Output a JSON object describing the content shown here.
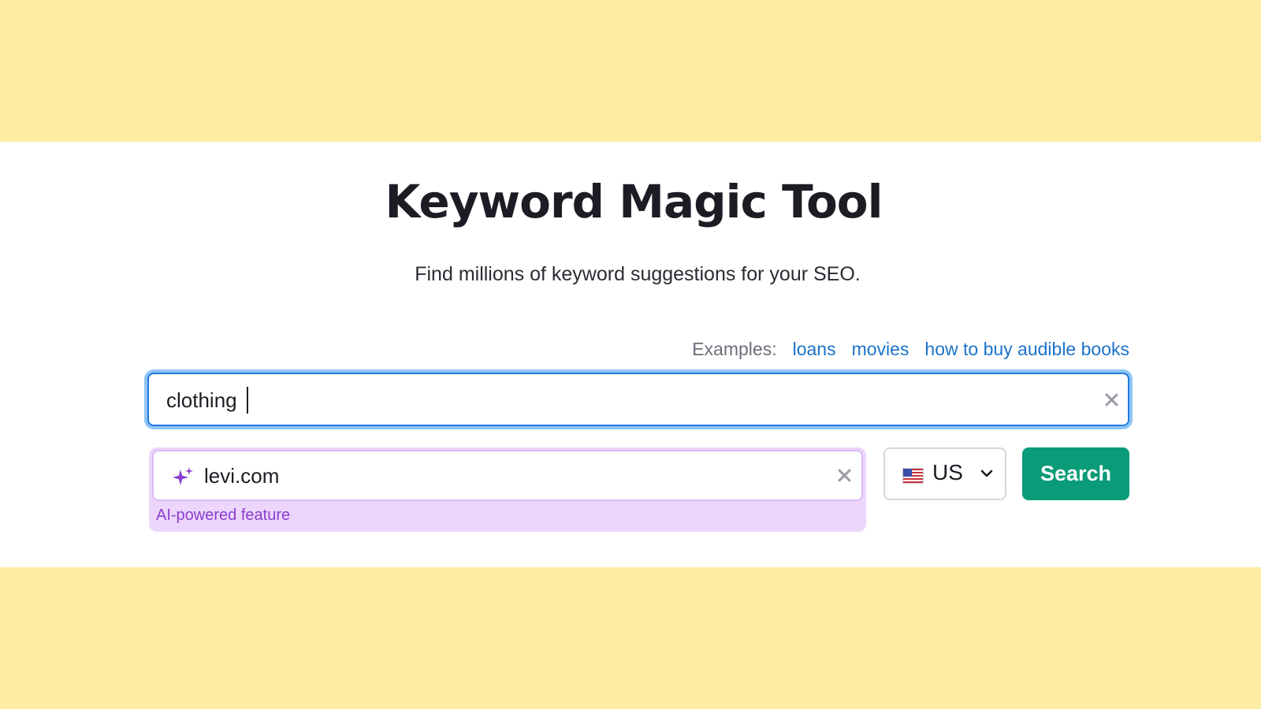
{
  "header": {
    "title": "Keyword Magic Tool",
    "subtitle": "Find millions of keyword suggestions for your SEO."
  },
  "examples": {
    "label": "Examples:",
    "items": [
      "loans",
      "movies",
      "how to buy audible books"
    ]
  },
  "keyword_input": {
    "value": "clothing",
    "placeholder": ""
  },
  "ai_domain": {
    "value": "levi.com",
    "placeholder": "",
    "caption": "AI-powered feature",
    "icon": "sparkle-icon"
  },
  "country": {
    "code": "US",
    "flag_icon": "us-flag-icon"
  },
  "search_button": {
    "label": "Search"
  },
  "colors": {
    "background_band": "#fdeca1",
    "panel": "#ffffff",
    "accent_blue": "#1f7ae0",
    "link_blue": "#1a73c9",
    "ai_purple": "#8a3fd1",
    "ai_bg": "#ecd6fb",
    "search_green": "#0a9b78"
  }
}
